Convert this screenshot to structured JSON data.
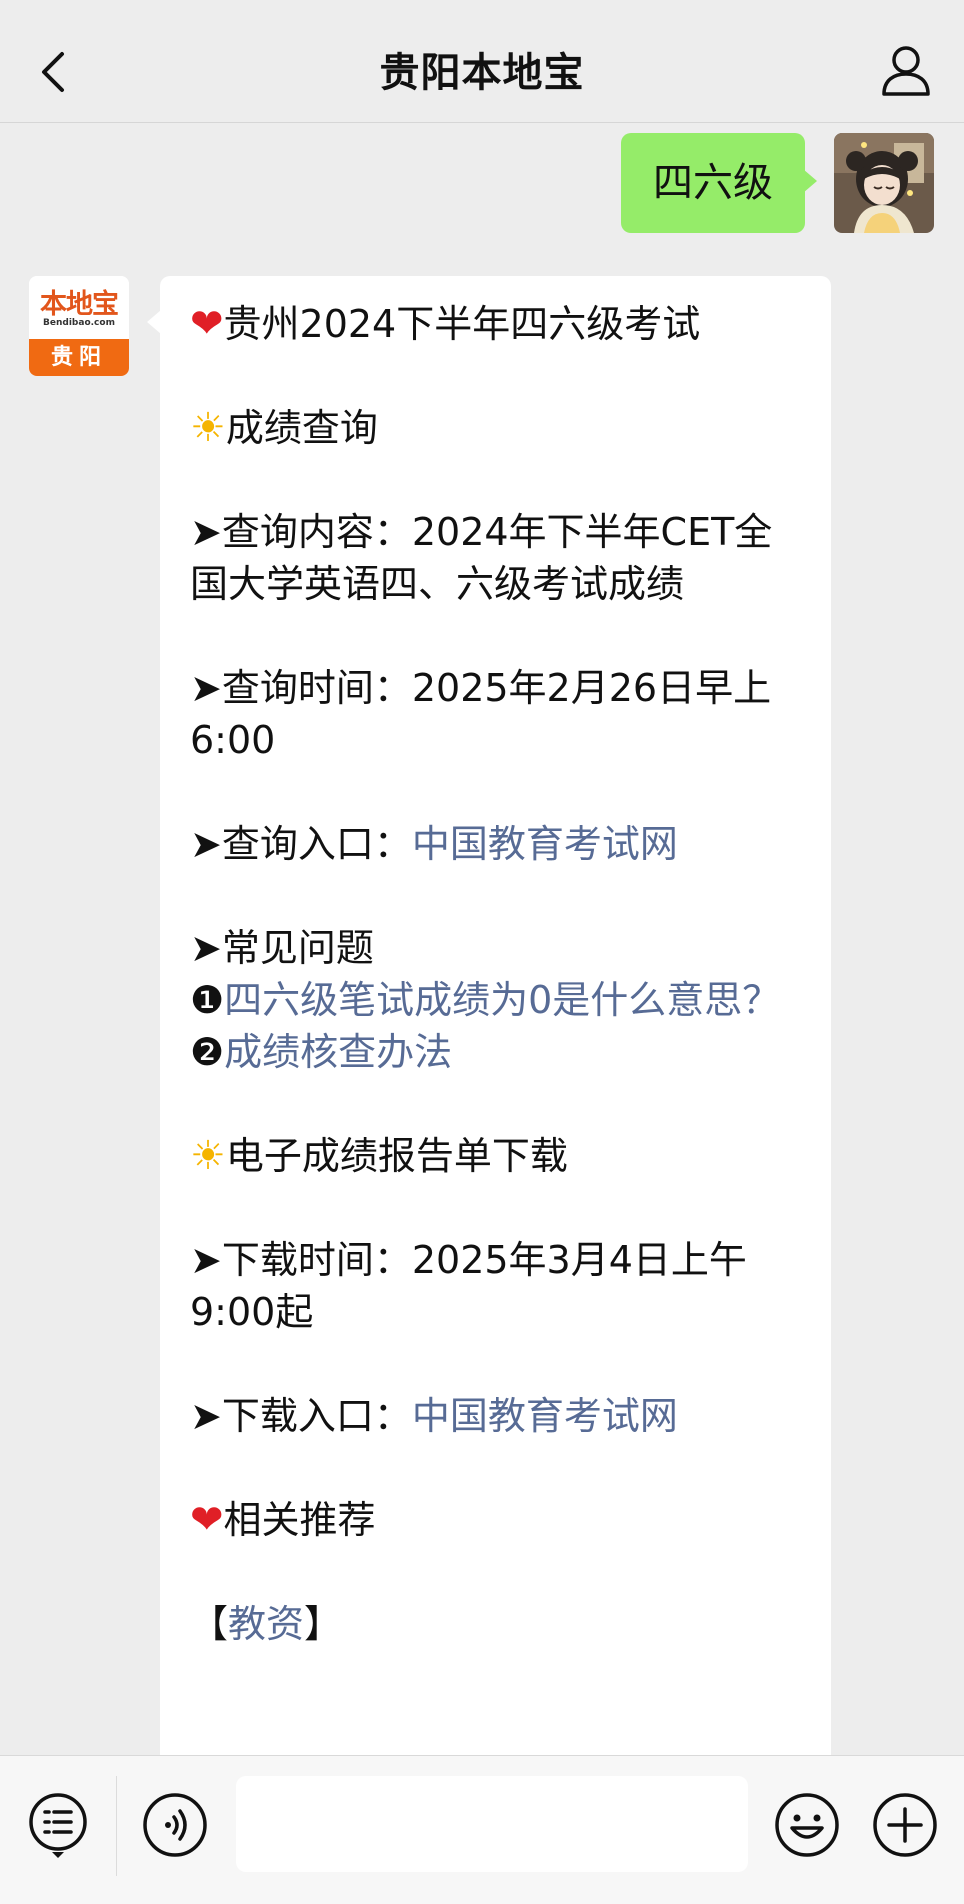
{
  "header": {
    "title": "贵阳本地宝"
  },
  "outgoing": {
    "text": "四六级"
  },
  "bot_avatar": {
    "logo_main": "本地宝",
    "logo_sub": "Bendibao.com",
    "logo_city": "贵阳"
  },
  "message": {
    "title": "贵州2024下半年四六级考试",
    "section1": "成绩查询",
    "query_content_label": "➤查询内容：",
    "query_content_value": "2024年下半年CET全国大学英语四、六级考试成绩",
    "query_time_label": "➤查询时间：",
    "query_time_value": "2025年2月26日早上6:00",
    "query_entry_label": "➤查询入口：",
    "query_entry_link": "中国教育考试网",
    "faq_label": "➤常见问题",
    "faq1_num": "❶",
    "faq1_link": "四六级笔试成绩为0是什么意思？",
    "faq2_num": "❷",
    "faq2_link": "成绩核查办法",
    "section2": "电子成绩报告单下载",
    "download_time_label": "➤下载时间：",
    "download_time_value": "2025年3月4日上午9:00起",
    "download_entry_label": "➤下载入口：",
    "download_entry_link": "中国教育考试网",
    "section3": "相关推荐",
    "rec1_open": "【",
    "rec1_link": "教资",
    "rec1_close": "】"
  },
  "icons": {
    "back": "chevron-left-icon",
    "profile": "person-icon",
    "menu": "list-menu-icon",
    "voice": "voice-icon",
    "emoji": "emoji-icon",
    "plus": "plus-icon",
    "heart": "heart-icon",
    "sun": "sun-icon"
  },
  "colors": {
    "bubble_out": "#95ec69",
    "link": "#576b95",
    "background": "#ededed",
    "brand_orange": "#f06a12"
  }
}
